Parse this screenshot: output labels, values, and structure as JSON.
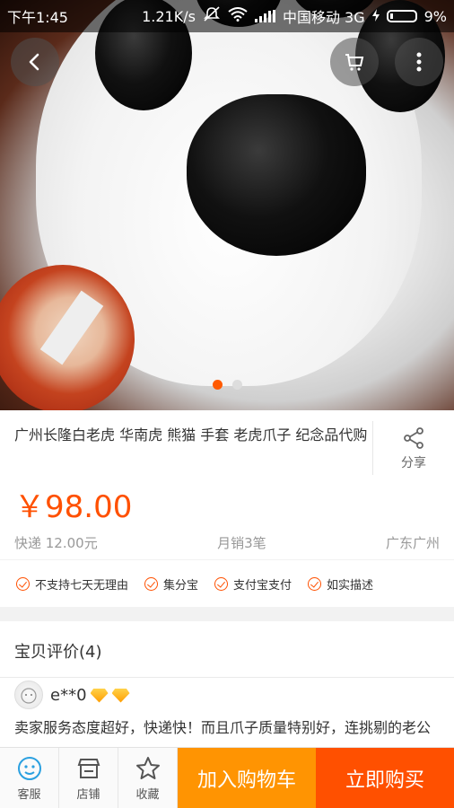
{
  "status_bar": {
    "time": "下午1:45",
    "speed": "1.21K/s",
    "carrier": "中国移动 3G",
    "battery": "9%",
    "icons": [
      "mute-icon",
      "wifi-icon",
      "signal-icon",
      "charging-icon",
      "battery-icon"
    ]
  },
  "nav": {
    "icons": [
      "back-icon",
      "cart-icon",
      "more-icon"
    ]
  },
  "carousel": {
    "count": 2,
    "active_index": 0,
    "active_color": "#ff5a00"
  },
  "product": {
    "title": "广州长隆白老虎 华南虎 熊猫 手套 老虎爪子 纪念品代购",
    "share_label": "分享",
    "price": "￥98.00",
    "shipping": "快递 12.00元",
    "monthly_sales": "月销3笔",
    "location": "广东广州"
  },
  "guarantees": [
    "不支持七天无理由",
    "集分宝",
    "支付宝支付",
    "如实描述"
  ],
  "reviews": {
    "title": "宝贝评价(4)",
    "user": "e**0",
    "text": "卖家服务态度超好，快递快！而且爪子质量特别好，连挑剔的老公都说质量没说的！全五星"
  },
  "bottom_bar": {
    "service_label": "客服",
    "store_label": "店铺",
    "favorite_label": "收藏",
    "add_cart_label": "加入购物车",
    "buy_now_label": "立即购买",
    "add_cart_color": "#ff9402",
    "buy_now_color": "#ff5000"
  },
  "colors": {
    "accent": "#ff5000"
  }
}
